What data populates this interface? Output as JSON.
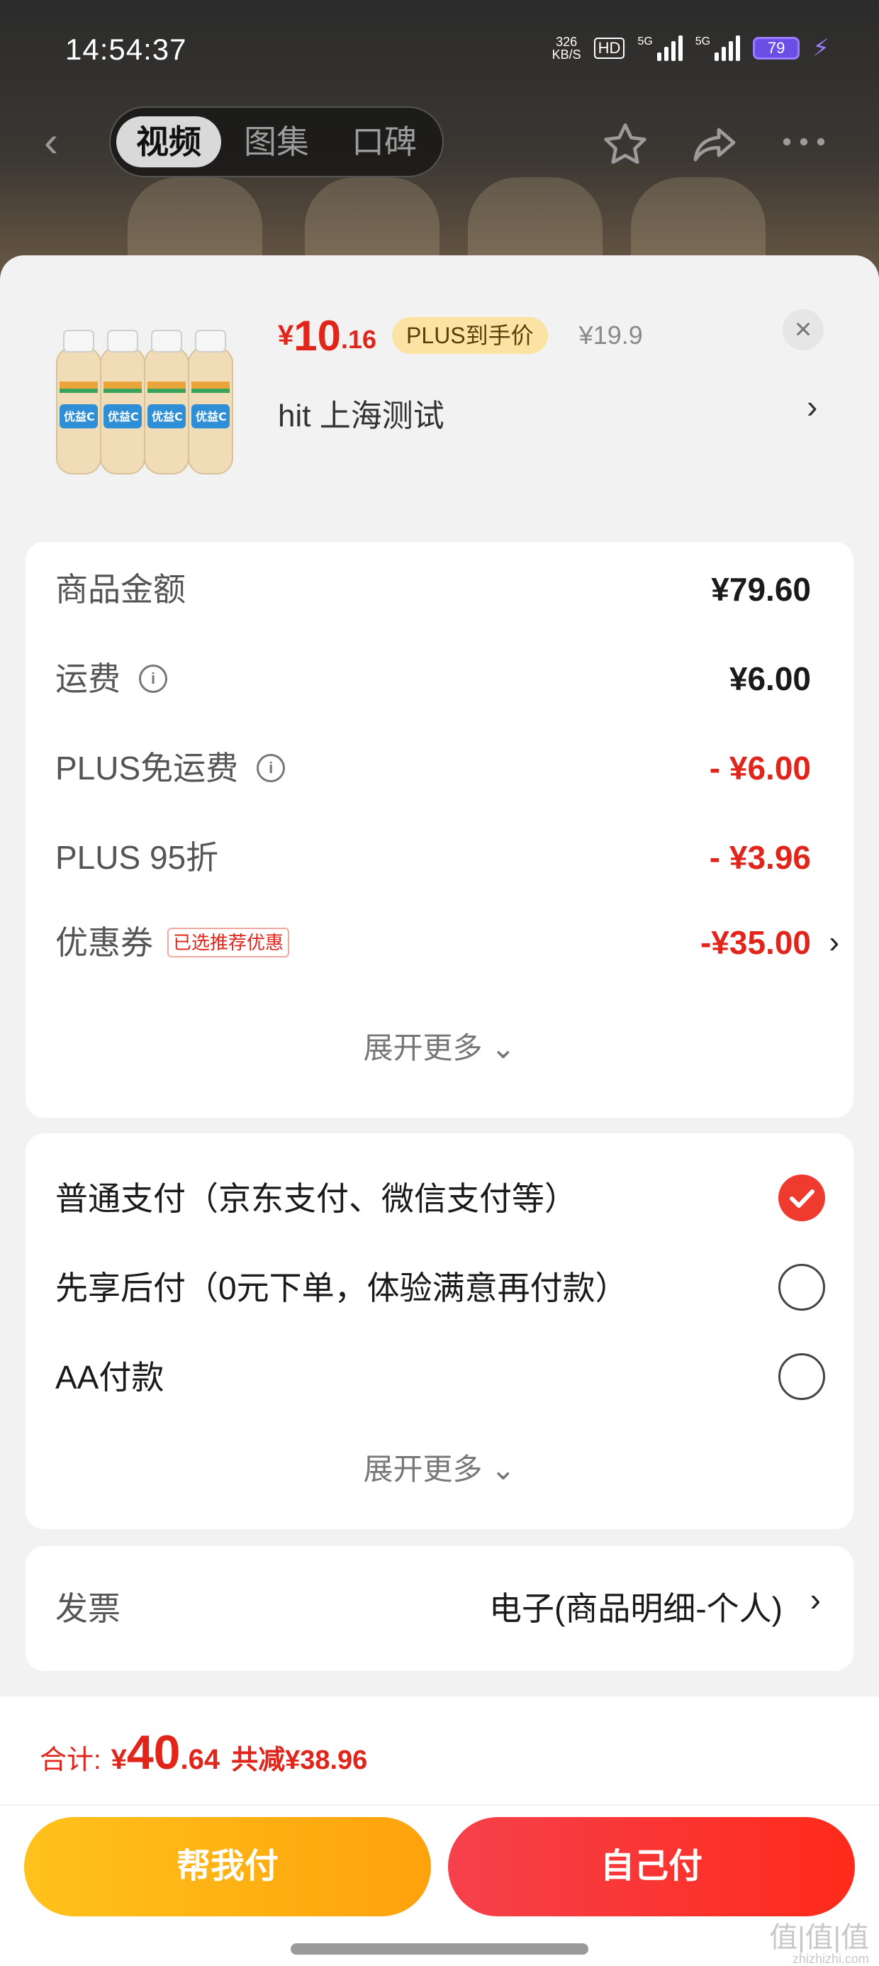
{
  "status_bar": {
    "time": "14:54:37",
    "speed_value": "326",
    "speed_unit": "KB/S",
    "hd": "HD",
    "net1": "5G",
    "net2": "5G",
    "battery": "79"
  },
  "nav": {
    "tabs": [
      "视频",
      "图集",
      "口碑"
    ],
    "active_tab": 0
  },
  "product": {
    "price_symbol": "¥",
    "price_int": "10",
    "price_dec": ".16",
    "plus_tag": "PLUS到手价",
    "original_price": "¥19.9",
    "address": "hit  上海测试",
    "thumb_brand": "优益C",
    "close_icon": "close-icon"
  },
  "summary": {
    "rows": [
      {
        "label": "商品金额",
        "value": "¥79.60",
        "info": false,
        "red": false
      },
      {
        "label": "运费",
        "value": "¥6.00",
        "info": true,
        "red": false
      },
      {
        "label": "PLUS免运费",
        "value": "- ¥6.00",
        "info": true,
        "red": true
      },
      {
        "label": "PLUS 95折",
        "value": "- ¥3.96",
        "info": false,
        "red": true
      }
    ],
    "coupon": {
      "label": "优惠券",
      "tag": "已选推荐优惠",
      "value": "-¥35.00"
    },
    "expand": "展开更多"
  },
  "payment": {
    "options": [
      {
        "label": "普通支付（京东支付、微信支付等）",
        "selected": true
      },
      {
        "label": "先享后付（0元下单，体验满意再付款）",
        "selected": false
      },
      {
        "label": "AA付款",
        "selected": false
      }
    ],
    "expand": "展开更多"
  },
  "invoice": {
    "label": "发票",
    "value": "电子(商品明细-个人)"
  },
  "footer": {
    "total_label": "合计:",
    "total_symbol": "¥",
    "total_int": "40",
    "total_dec": ".64",
    "saving": "共减¥38.96",
    "help_pay": "帮我付",
    "self_pay": "自己付"
  },
  "watermark": {
    "logo": "值|值|值",
    "site": "zhizhizhi.com"
  },
  "colors": {
    "accent_red": "#e1251b",
    "help_btn": "#ffb412",
    "self_btn": "#f5414d",
    "plus_tag_bg": "#fbe3a4"
  }
}
